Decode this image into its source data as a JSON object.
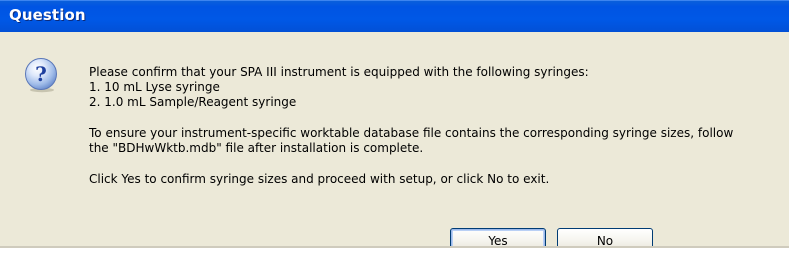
{
  "window": {
    "title": "Question"
  },
  "icon": {
    "name": "question-icon",
    "glyph": "?"
  },
  "message": {
    "lines": [
      "Please confirm that your SPA III instrument is equipped with the following syringes:",
      "1. 10 mL Lyse syringe",
      "2. 1.0 mL Sample/Reagent syringe",
      "To ensure your instrument-specific worktable database file contains the corresponding syringe sizes, follow",
      "the \"BDHwWktb.mdb\" file after installation is complete.",
      "Click Yes to confirm syringe sizes and proceed with setup, or click No to exit."
    ]
  },
  "buttons": {
    "yes_label": "Yes",
    "no_label": "No"
  },
  "colors": {
    "titlebar": "#0058e6",
    "dialog_face": "#ece9d8",
    "button_border": "#003c74"
  }
}
